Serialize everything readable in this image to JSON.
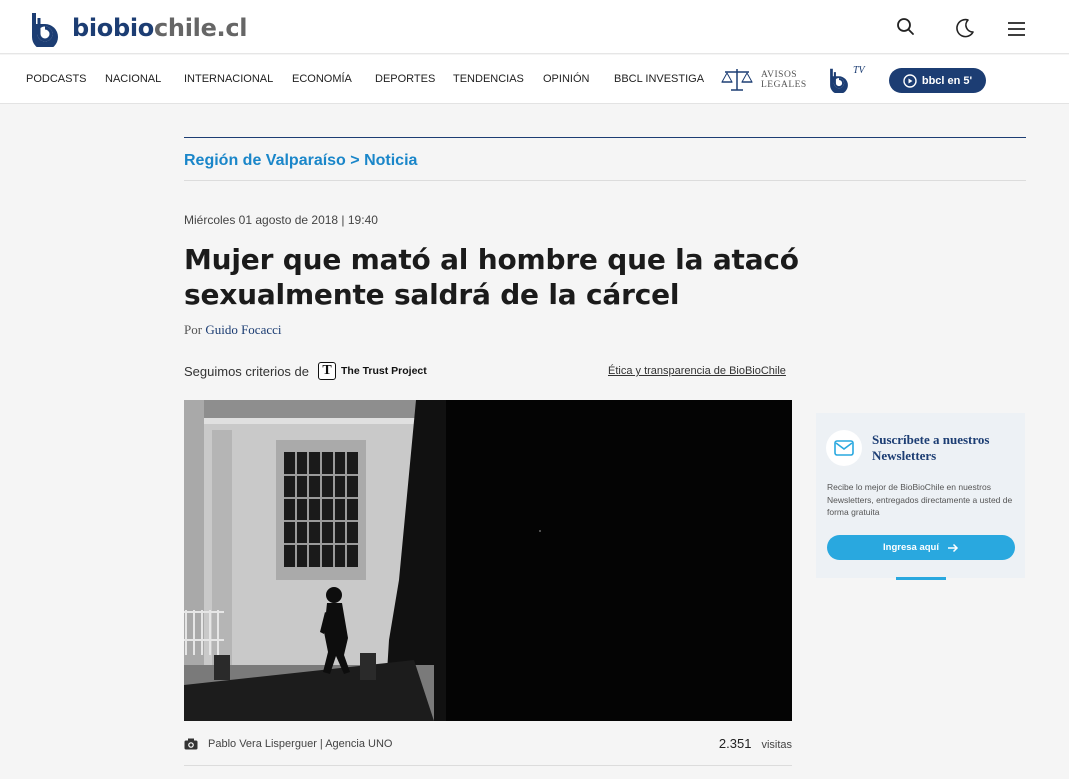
{
  "header": {
    "logo": {
      "part_a": "biobio",
      "part_b": "chile.cl"
    },
    "icons": [
      "search-icon",
      "moon-icon",
      "menu-icon"
    ]
  },
  "nav": {
    "items": [
      "PODCASTS",
      "NACIONAL",
      "INTERNACIONAL",
      "ECONOMÍA",
      "DEPORTES",
      "TENDENCIAS",
      "OPINIÓN",
      "BBCL INVESTIGA"
    ],
    "avisos_line1": "AVISOS",
    "avisos_line2": "LEGALES",
    "tv_label": "TV",
    "bbcl_button": "bbcl en 5'"
  },
  "article": {
    "breadcrumb_section": "Región de Valparaíso",
    "breadcrumb_sep": ">",
    "breadcrumb_type": "Noticia",
    "date": "Miércoles 01 agosto de 2018 | 19:40",
    "headline": "Mujer que mató al hombre que la atacó sexualmente saldrá de la cárcel",
    "byline_prefix": "Por",
    "author": "Guido Focacci",
    "trust_prefix": "Seguimos criterios de",
    "trust_name": "The Trust Project",
    "ethics_link": "Ética y transparencia de BioBioChile",
    "photo_credit": "Pablo Vera Lisperguer | Agencia UNO",
    "visits_count": "2.351",
    "visits_label": "visitas"
  },
  "newsletter": {
    "title": "Suscríbete a nuestros Newsletters",
    "description": "Recibe lo mejor de BioBioChile en nuestros Newsletters, entregados directamente a usted de forma gratuita",
    "button": "Ingresa aquí"
  },
  "colors": {
    "brand_navy": "#1c3d73",
    "link_blue": "#1a86c9",
    "newsletter_accent": "#29a8df"
  }
}
